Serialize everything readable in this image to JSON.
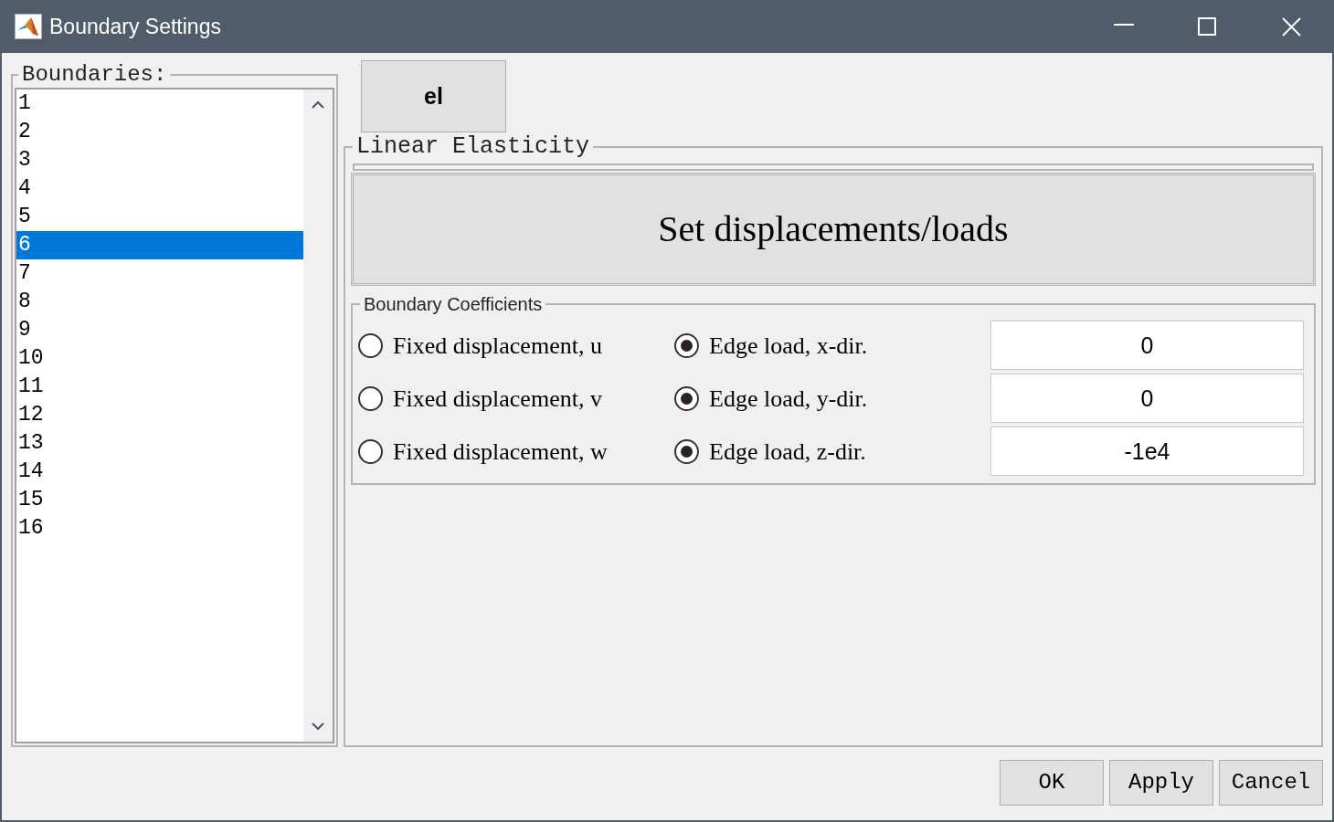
{
  "window": {
    "title": "Boundary Settings"
  },
  "boundaries": {
    "label": "Boundaries:",
    "items": [
      {
        "label": "1",
        "selected": false
      },
      {
        "label": "2",
        "selected": false
      },
      {
        "label": "3",
        "selected": false
      },
      {
        "label": "4",
        "selected": false
      },
      {
        "label": "5",
        "selected": false
      },
      {
        "label": "6",
        "selected": true
      },
      {
        "label": "7",
        "selected": false
      },
      {
        "label": "8",
        "selected": false
      },
      {
        "label": "9",
        "selected": false
      },
      {
        "label": "10",
        "selected": false
      },
      {
        "label": "11",
        "selected": false
      },
      {
        "label": "12",
        "selected": false
      },
      {
        "label": "13",
        "selected": false
      },
      {
        "label": "14",
        "selected": false
      },
      {
        "label": "15",
        "selected": false
      },
      {
        "label": "16",
        "selected": false
      }
    ]
  },
  "tabs": [
    {
      "label": "el",
      "selected": true
    }
  ],
  "panel": {
    "title": "Linear Elasticity",
    "action_button": "Set displacements/loads",
    "coefficients": {
      "title": "Boundary Coefficients",
      "rows": [
        {
          "fixed": {
            "label": "Fixed displacement, u",
            "selected": false
          },
          "load": {
            "label": "Edge load, x-dir.",
            "selected": true
          },
          "value": "0"
        },
        {
          "fixed": {
            "label": "Fixed displacement, v",
            "selected": false
          },
          "load": {
            "label": "Edge load, y-dir.",
            "selected": true
          },
          "value": "0"
        },
        {
          "fixed": {
            "label": "Fixed displacement, w",
            "selected": false
          },
          "load": {
            "label": "Edge load, z-dir.",
            "selected": true
          },
          "value": "-1e4"
        }
      ]
    }
  },
  "buttons": [
    "OK",
    "Apply",
    "Cancel"
  ]
}
